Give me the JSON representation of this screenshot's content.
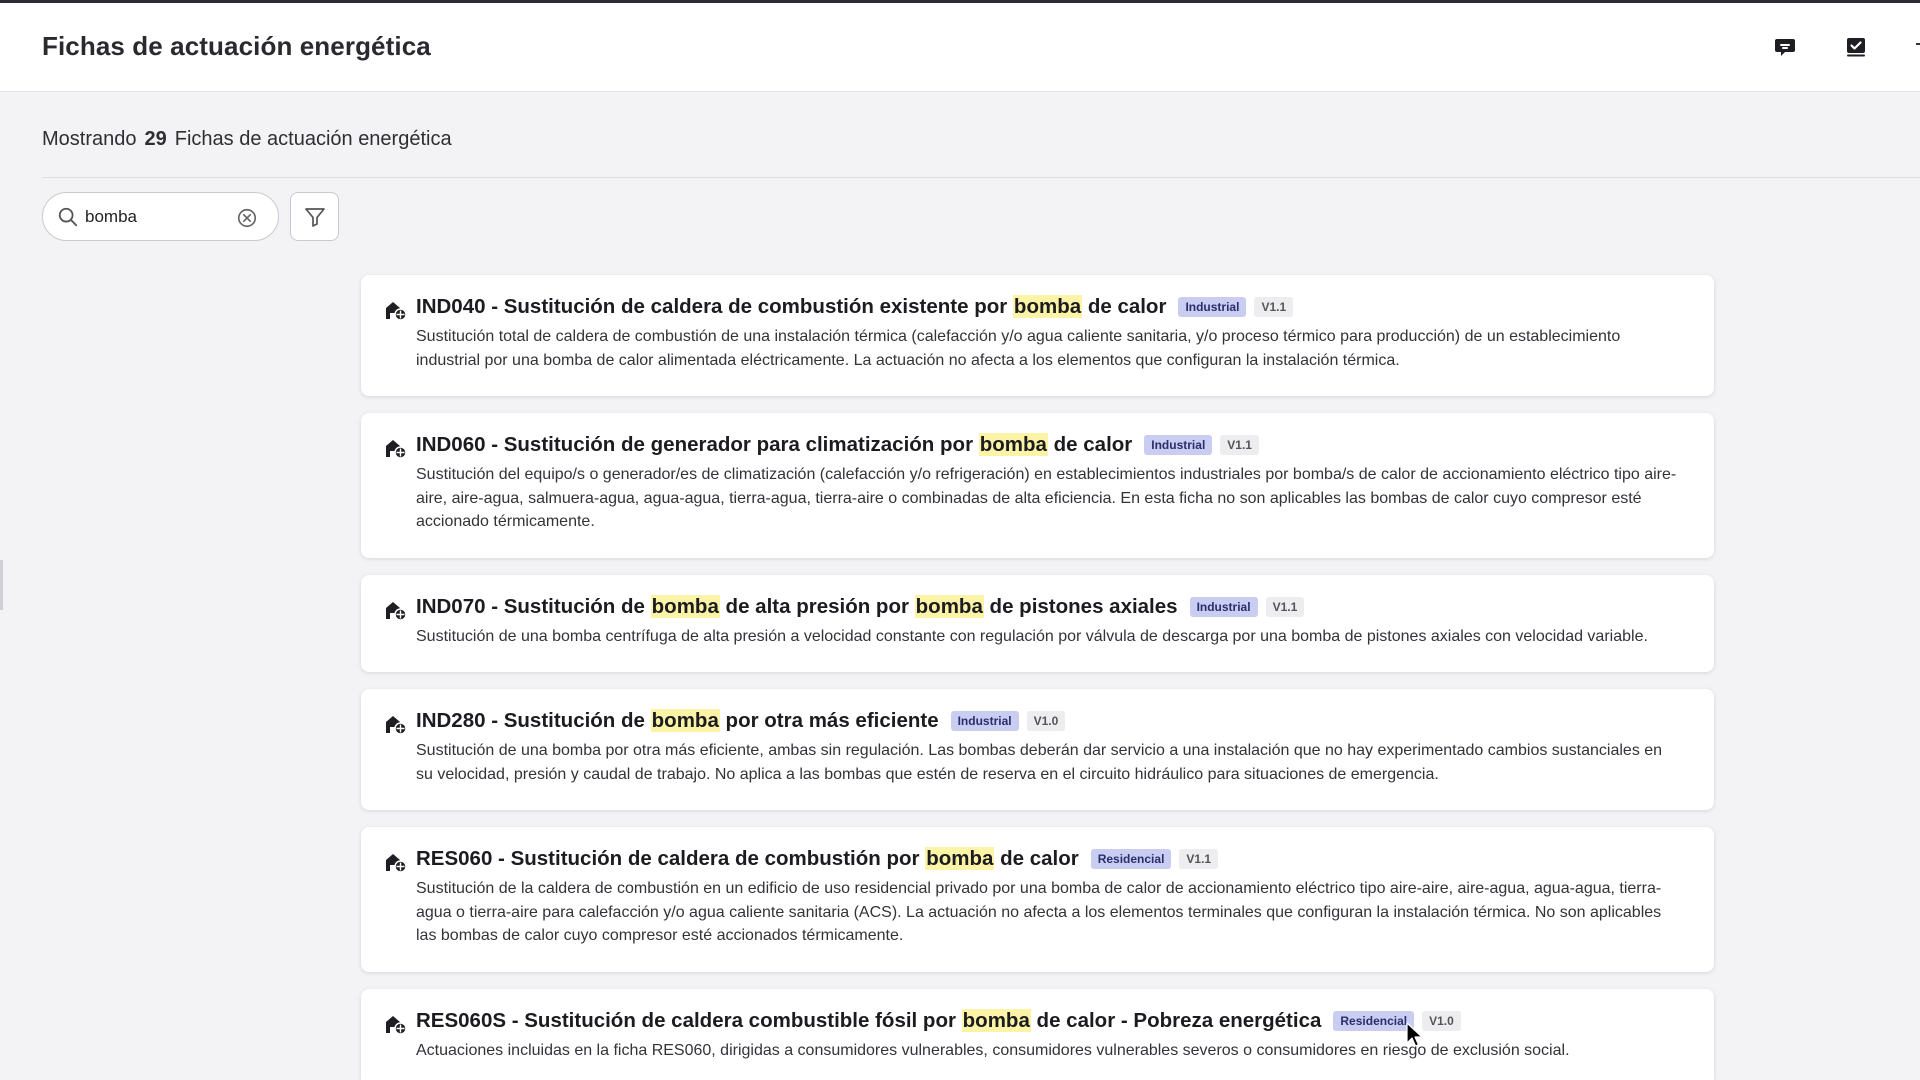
{
  "header": {
    "title": "Fichas de actuación energética"
  },
  "summary": {
    "prefix": "Mostrando",
    "count": "29",
    "suffix": "Fichas de actuación energética"
  },
  "search": {
    "value": "bomba"
  },
  "highlight_term": "bomba",
  "colors": {
    "highlight": "#fbf3a6",
    "sector_tag_bg": "#c9cdf1",
    "sector_tag_text": "#2a2f6b",
    "version_tag_bg": "#ededef"
  },
  "cards": [
    {
      "title": "IND040 - Sustitución de caldera de combustión existente por bomba de calor",
      "sector": "Industrial",
      "version": "V1.1",
      "description": "Sustitución total de caldera de combustión de una instalación térmica (calefacción y/o agua caliente sanitaria, y/o proceso térmico para producción) de un establecimiento industrial por una bomba de calor alimentada eléctricamente. La actuación no afecta a los elementos que configuran la instalación térmica."
    },
    {
      "title": "IND060 - Sustitución de generador para climatización por bomba de calor",
      "sector": "Industrial",
      "version": "V1.1",
      "description": "Sustitución del equipo/s o generador/es de climatización (calefacción y/o refrigeración) en establecimientos industriales por bomba/s de calor de accionamiento eléctrico tipo aire-aire, aire-agua, salmuera-agua, agua-agua, tierra-agua, tierra-aire o combinadas de alta eficiencia. En esta ficha no son aplicables las bombas de calor cuyo compresor esté accionado térmicamente."
    },
    {
      "title": "IND070 - Sustitución de bomba de alta presión por bomba de pistones axiales",
      "sector": "Industrial",
      "version": "V1.1",
      "description": "Sustitución de una bomba centrífuga de alta presión a velocidad constante con regulación por válvula de descarga por una bomba de pistones axiales con velocidad variable."
    },
    {
      "title": "IND280 - Sustitución de bomba por otra más eficiente",
      "sector": "Industrial",
      "version": "V1.0",
      "description": "Sustitución de una bomba por otra más eficiente, ambas sin regulación. Las bombas deberán dar servicio a una instalación que no hay experimentado cambios sustanciales en su velocidad, presión y caudal de trabajo. No aplica a las bombas que estén de reserva en el circuito hidráulico para situaciones de emergencia."
    },
    {
      "title": "RES060 - Sustitución de caldera de combustión por bomba de calor",
      "sector": "Residencial",
      "version": "V1.1",
      "description": "Sustitución de la caldera de combustión en un edificio de uso residencial privado por una bomba de calor de accionamiento eléctrico tipo aire-aire, aire-agua, agua-agua, tierra-agua o tierra-aire para calefacción y/o agua caliente sanitaria (ACS). La actuación no afecta a los elementos terminales que configuran la instalación térmica. No son aplicables las bombas de calor cuyo compresor esté accionados térmicamente."
    },
    {
      "title": "RES060S - Sustitución de caldera combustible fósil por bomba de calor - Pobreza energética",
      "sector": "Residencial",
      "version": "V1.0",
      "description": "Actuaciones incluidas en la ficha RES060, dirigidas a consumidores vulnerables, consumidores vulnerables severos o consumidores en riesgo de exclusión social."
    }
  ]
}
